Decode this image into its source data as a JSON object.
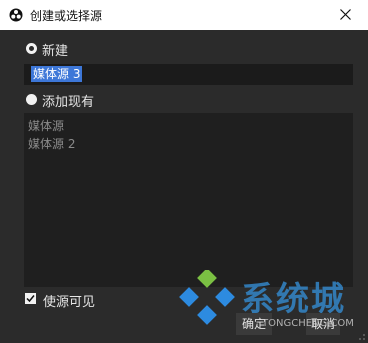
{
  "window": {
    "title": "创建或选择源",
    "app_icon": "obs-icon",
    "close_icon": "close-icon"
  },
  "options": {
    "create_new_label": "新建",
    "add_existing_label": "添加现有",
    "selected": "create_new"
  },
  "name_input": {
    "value": "媒体源 3"
  },
  "existing_sources": [
    "媒体源",
    "媒体源 2"
  ],
  "visibility_checkbox": {
    "label": "使源可见",
    "checked": true
  },
  "buttons": {
    "ok": "确定",
    "cancel": "取消"
  },
  "watermark": {
    "text": "系统城",
    "url": "TONGCHENG.COM"
  },
  "colors": {
    "selection": "#3d77d8",
    "background": "#2b2b2b",
    "watermark": "#3486c8"
  }
}
